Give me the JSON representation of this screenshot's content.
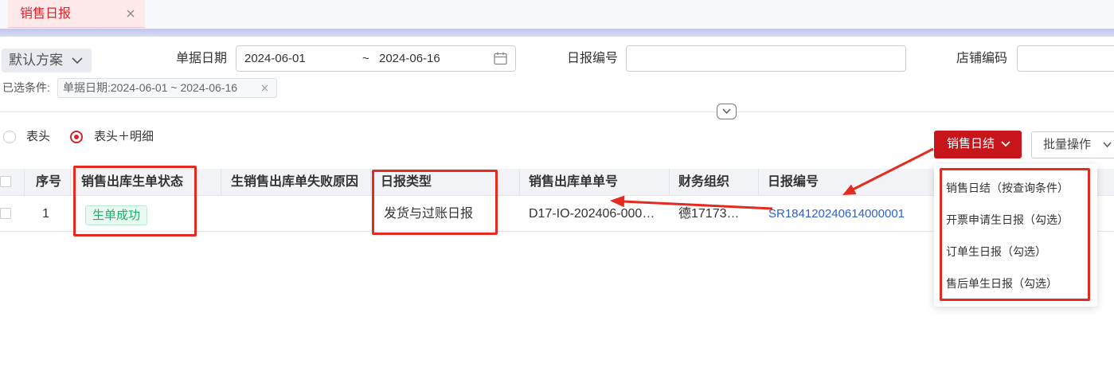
{
  "tabs": [
    {
      "label": "销售日报",
      "close": "×"
    }
  ],
  "filters": {
    "scheme_label": "默认方案",
    "date_label": "单据日期",
    "date_start": "2024-06-01",
    "date_sep": "~",
    "date_end": "2024-06-16",
    "report_no_label": "日报编号",
    "report_no_value": "",
    "shop_code_label": "店铺编码",
    "shop_code_value": ""
  },
  "selected_conditions": {
    "label": "已选条件:",
    "tags": [
      {
        "text": "单据日期:2024-06-01 ~ 2024-06-16",
        "close": "×"
      }
    ]
  },
  "view_mode": {
    "options": [
      {
        "label": "表头",
        "selected": false
      },
      {
        "label": "表头＋明细",
        "selected": true
      }
    ]
  },
  "actions": {
    "daily_close_label": "销售日结",
    "batch_label": "批量操作"
  },
  "table": {
    "columns": [
      "序号",
      "销售出库生单状态",
      "生销售出库单失败原因",
      "日报类型",
      "销售出库单单号",
      "财务组织",
      "日报编号"
    ],
    "rows": [
      {
        "index": "1",
        "status": "生单成功",
        "fail_reason": "",
        "report_type": "发货与过账日报",
        "outbound_no": "D17-IO-202406-000…",
        "finance_org": "德17173…",
        "report_no": "SR184120240614000001"
      }
    ]
  },
  "dropdown_menu": {
    "items": [
      "销售日结（按查询条件）",
      "开票申请生日报（勾选）",
      "订单生日报（勾选）",
      "售后单生日报（勾选）"
    ]
  },
  "icons": [
    "close-icon",
    "chevron-down-icon",
    "calendar-icon"
  ],
  "colors": {
    "accent": "#c8151c",
    "tab_text": "#d8262d",
    "tab_bg": "#fde9ea",
    "success": "#19b36b",
    "link": "#2f5fd0",
    "annotation": "#e52a1f"
  }
}
